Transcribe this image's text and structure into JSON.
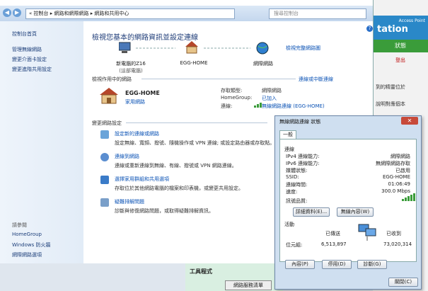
{
  "address_bar": {
    "breadcrumb": "« 控制台 ▸ 網路和網際網路 ▸ 網路和共用中心",
    "search_placeholder": "搜尋控制台"
  },
  "sidebar": {
    "items": [
      "控制台首頁",
      "管理無線網路",
      "變更介面卡設定",
      "變更進階共用設定"
    ],
    "see_also_heading": "請參閱",
    "see_also": [
      "HomeGroup",
      "Windows 防火牆",
      "網際網路選項"
    ]
  },
  "main": {
    "title": "檢視您基本的網路資訊並設定連線",
    "full_map_link": "檢視完整網路圖",
    "map": {
      "computer": "新電腦的Z16",
      "computer_sub": "(這部電腦)",
      "network": "EGG-HOME",
      "internet": "網際網路"
    },
    "active_heading": "檢視作用中的網路",
    "connect_disconnect": "連線或中斷連線",
    "active_network": {
      "name": "EGG-HOME",
      "type": "家用網路",
      "access_type_label": "存取類型:",
      "access_type": "網際網路",
      "homegroup_label": "HomeGroup:",
      "homegroup": "已加入",
      "connections_label": "連線:",
      "connection": "無線網路連線 (EGG-HOME)"
    },
    "change_heading": "變更網路設定",
    "tasks": [
      {
        "title": "設定新的連線或網路",
        "desc": "設定無線、寬頻、撥號、隨機操作或 VPN 連線; 或設定路由器或存取點。"
      },
      {
        "title": "連線到網路",
        "desc": "連線或重新連線到無線、有線、撥號或 VPN 網路連線。"
      },
      {
        "title": "選擇家用群組和共用選項",
        "desc": "存取位於其他網路電腦的檔案和印表機，或變更共用設定。"
      },
      {
        "title": "疑難排解問題",
        "desc": "診斷與修復網路問題，或取得疑難排解資訊。"
      }
    ]
  },
  "dialog": {
    "title": "無線網路連線 狀態",
    "close": "✕",
    "tab": "一般",
    "connection_heading": "連線",
    "rows": [
      {
        "label": "IPv4 連線能力:",
        "value": "網際網路"
      },
      {
        "label": "IPv6 連線能力:",
        "value": "無網際網路存取"
      },
      {
        "label": "媒體狀態:",
        "value": "已啟用"
      },
      {
        "label": "SSID:",
        "value": "EGG-HOME"
      },
      {
        "label": "連線時間:",
        "value": "01:06:49"
      },
      {
        "label": "速度:",
        "value": "300.0 Mbps"
      }
    ],
    "signal_label": "訊號品質:",
    "details_button": "詳細資料(E)...",
    "wireless_props_button": "無線內容(W)",
    "activity_heading": "活動",
    "sent_label": "已傳送",
    "received_label": "已收到",
    "bytes_label": "位元組:",
    "bytes_sent": "6,513,897",
    "bytes_received": "73,020,314",
    "properties_button": "內容(P)",
    "disable_button": "停用(D)",
    "diagnose_button": "診斷(G)",
    "close_button": "關閉(C)"
  },
  "background_page": {
    "access_point": "Access Point",
    "big_text": "tation",
    "tab": "狀態",
    "logout": "登出",
    "text1": "到的精靈位於",
    "text2": "說明對應個本",
    "tools_label": "工具程式",
    "clear_button": "網路服務清單"
  },
  "colors": {
    "accent": "#0a52b5",
    "title": "#1e3c78",
    "signal": "#3a9c3a"
  }
}
